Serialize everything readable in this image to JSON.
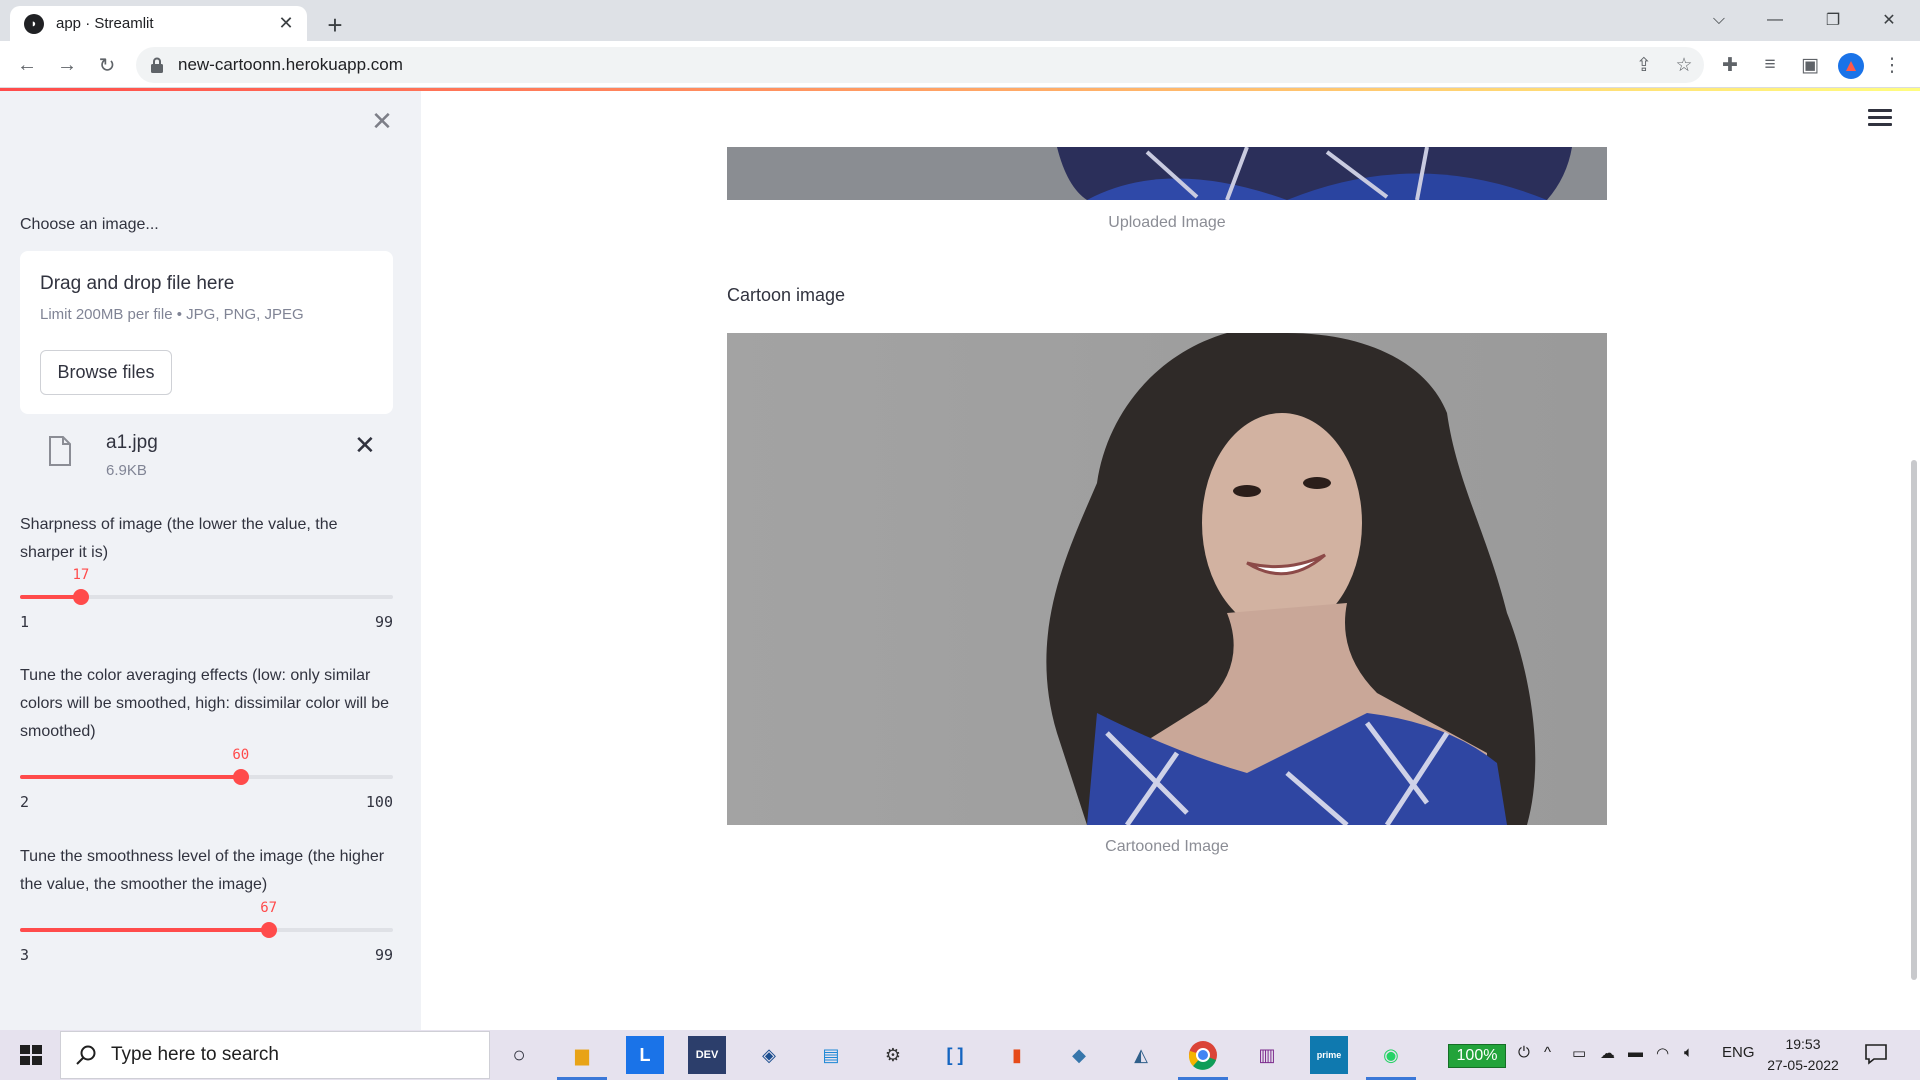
{
  "browser": {
    "tab_title": "app · Streamlit",
    "url": "new-cartoonn.herokuapp.com"
  },
  "sidebar": {
    "uploader_label": "Choose an image...",
    "dropzone_title": "Drag and drop file here",
    "dropzone_limit": "Limit 200MB per file • JPG, PNG, JPEG",
    "browse_button": "Browse files",
    "file_name": "a1.jpg",
    "file_size": "6.9KB",
    "sliders": [
      {
        "label": "Sharpness of image (the lower the value, the sharper it is)",
        "value": 17,
        "min": 1,
        "max": 99
      },
      {
        "label": "Tune the color averaging effects (low: only similar colors will be smoothed, high: dissimilar color will be smoothed)",
        "value": 60,
        "min": 2,
        "max": 100
      },
      {
        "label": "Tune the smoothness level of the image (the higher the value, the smoother the image)",
        "value": 67,
        "min": 3,
        "max": 99
      }
    ]
  },
  "main": {
    "uploaded_caption": "Uploaded Image",
    "cartoon_heading": "Cartoon image",
    "cartoon_caption": "Cartooned Image"
  },
  "taskbar": {
    "search_placeholder": "Type here to search",
    "battery": "100%",
    "language": "ENG",
    "time": "19:53",
    "date": "27-05-2022"
  },
  "colors": {
    "accent": "#ff4b4b",
    "sidebar_bg": "#f0f2f6",
    "taskbar_bg": "#e6e2ee"
  }
}
